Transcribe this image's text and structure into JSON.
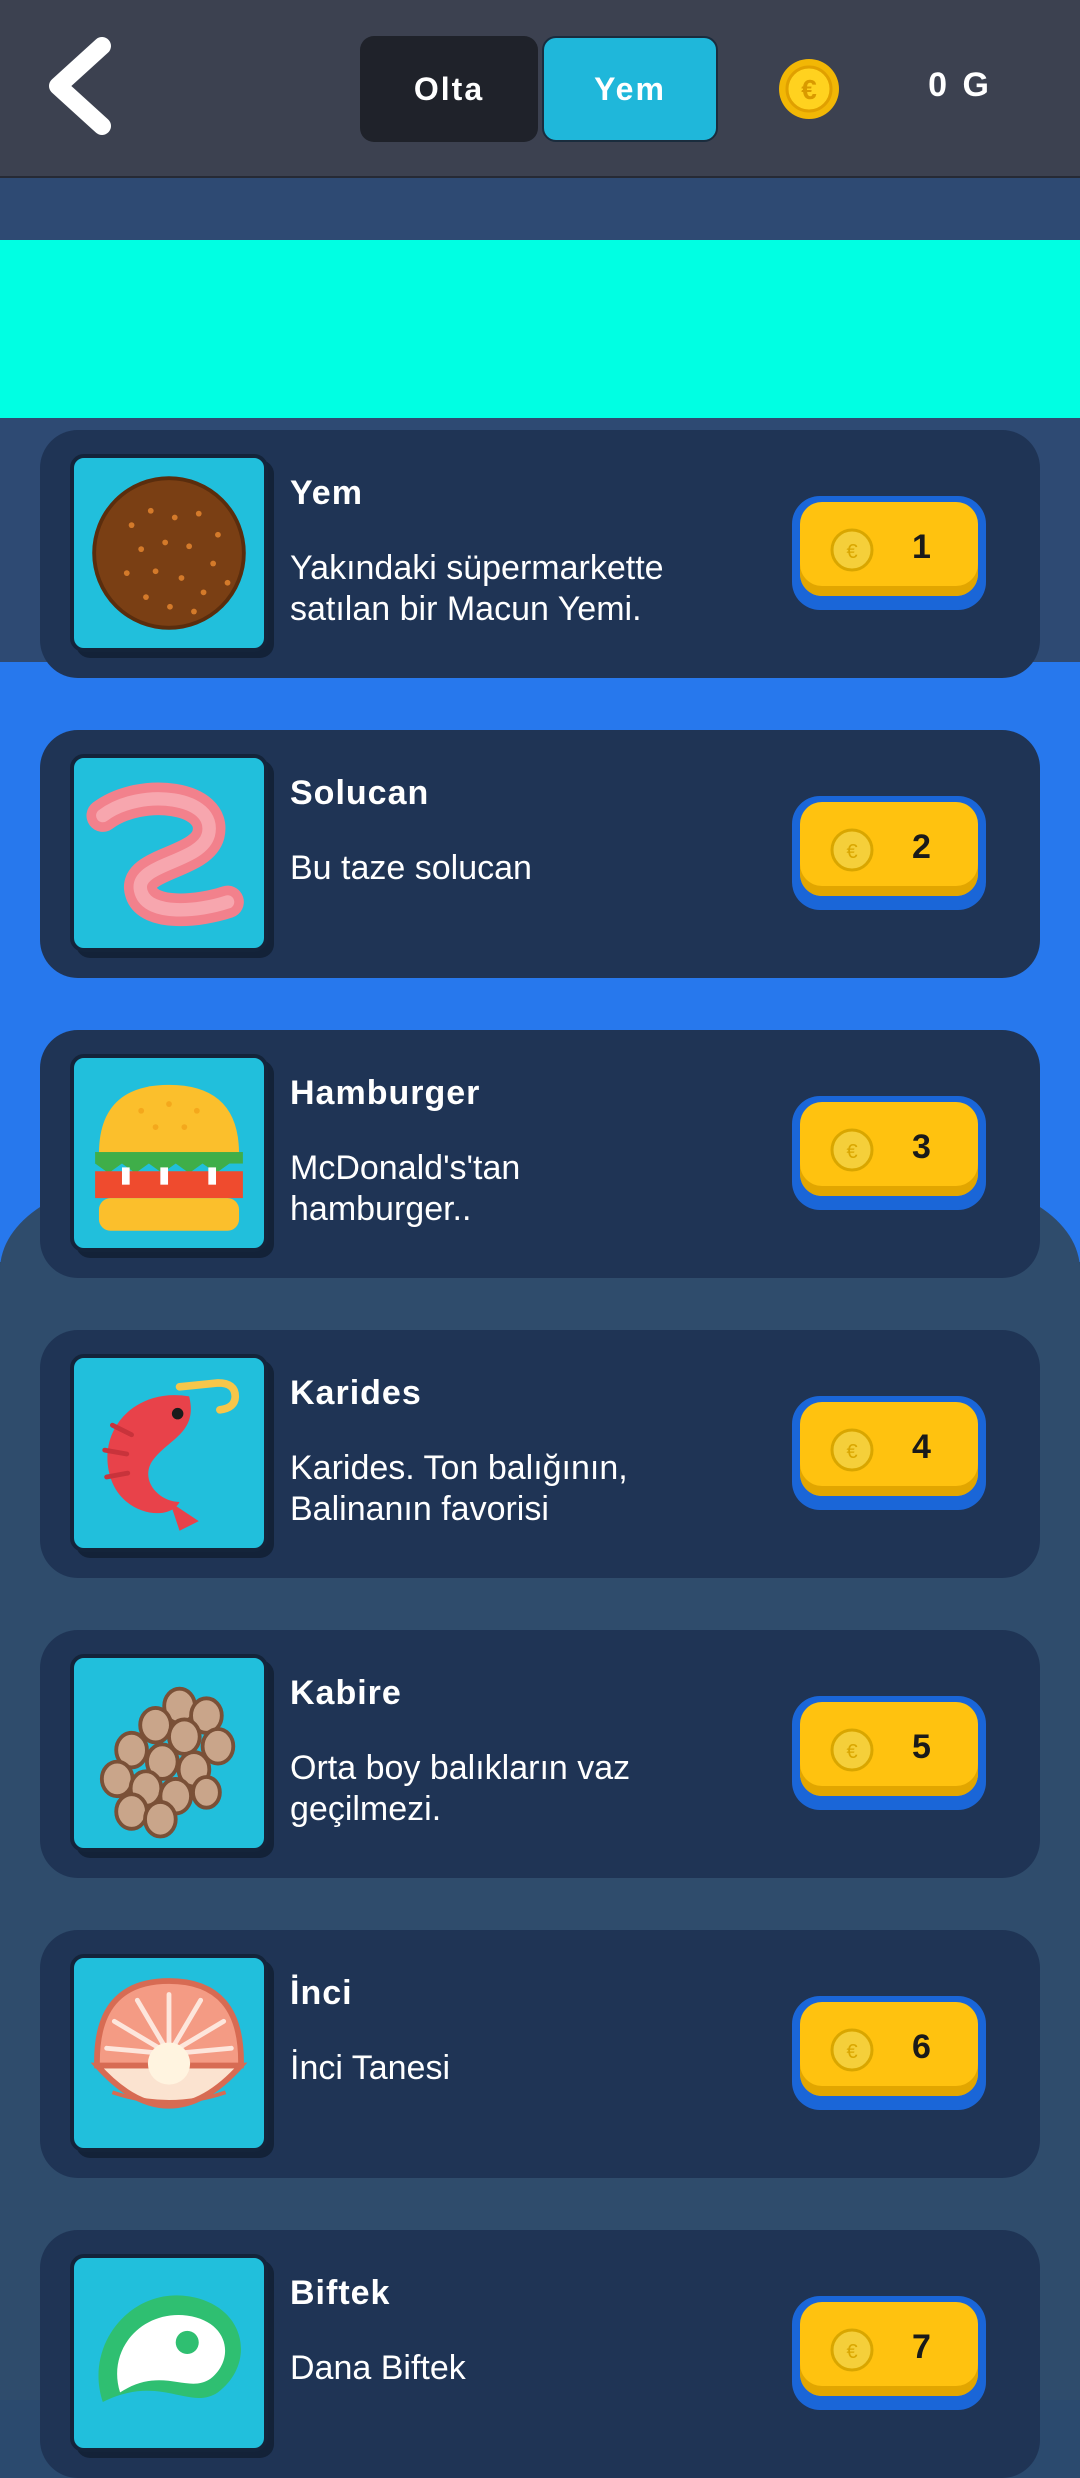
{
  "header": {
    "tabs": [
      {
        "label": "Olta",
        "active": false
      },
      {
        "label": "Yem",
        "active": true
      }
    ],
    "balance": "0 G"
  },
  "items": [
    {
      "name": "Yem",
      "description": "Yakındaki süpermarkette satılan bir Macun Yemi.",
      "price": "1",
      "icon": "bait-paste-icon"
    },
    {
      "name": "Solucan",
      "description": "Bu taze solucan",
      "price": "2",
      "icon": "worm-icon"
    },
    {
      "name": "Hamburger",
      "description": "McDonald's'tan hamburger..",
      "price": "3",
      "icon": "hamburger-icon"
    },
    {
      "name": "Karides",
      "description": "Karides. Ton balığının, Balinanın favorisi",
      "price": "4",
      "icon": "shrimp-icon"
    },
    {
      "name": "Kabire",
      "description": "Orta boy balıkların vaz geçilmezi.",
      "price": "5",
      "icon": "roe-icon"
    },
    {
      "name": "İnci",
      "description": "İnci Tanesi",
      "price": "6",
      "icon": "pearl-icon"
    },
    {
      "name": "Biftek",
      "description": "Dana Biftek",
      "price": "7",
      "icon": "steak-icon"
    }
  ],
  "colors": {
    "header_bg": "#3c4150",
    "active_tab": "#1fb7da",
    "banner": "#00ffe3",
    "card_bg": "#1f3455",
    "buy_button": "#ffc20f"
  }
}
